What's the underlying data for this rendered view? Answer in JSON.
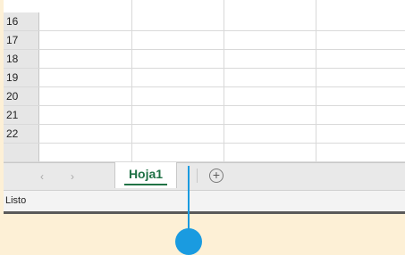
{
  "rows": [
    "16",
    "17",
    "18",
    "19",
    "20",
    "21",
    "22"
  ],
  "sheet_tabs": {
    "active": "Hoja1"
  },
  "nav": {
    "prev": "‹",
    "next": "›"
  },
  "add_sheet_symbol": "+",
  "status_bar": {
    "text": "Listo"
  },
  "colors": {
    "accent_green": "#217346",
    "callout_blue": "#1a9be0",
    "background": "#fdf0d6"
  }
}
